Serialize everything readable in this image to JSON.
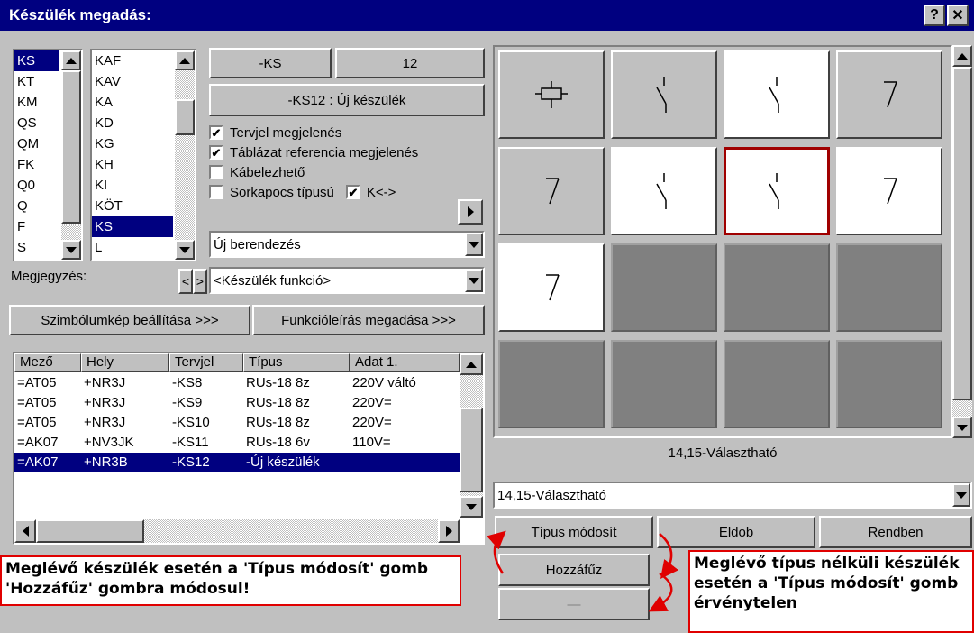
{
  "window": {
    "title": "Készülék megadás:",
    "help_label": "?",
    "close_label": "✕"
  },
  "prefix_list": {
    "items": [
      "KS",
      "KT",
      "KM",
      "QS",
      "QM",
      "FK",
      "Q0",
      "Q",
      "F",
      "S"
    ],
    "selected": 0
  },
  "type_list": {
    "items": [
      "KAF",
      "KAV",
      "KA",
      "KD",
      "KG",
      "KH",
      "KI",
      "KÖT",
      "KS",
      "L"
    ],
    "selected": 8
  },
  "designation": {
    "prefix": "-KS",
    "number": "12",
    "full": "-KS12  :  Új készülék"
  },
  "checkboxes": {
    "tervjel": {
      "label": "Tervjel megjelenés",
      "checked": true
    },
    "tablazat": {
      "label": "Táblázat referencia megjelenés",
      "checked": true
    },
    "kabelezheto": {
      "label": "Kábelezhető",
      "checked": false
    },
    "sorkapocs": {
      "label": "Sorkapocs típusú",
      "checked": false
    },
    "k": {
      "label": "K<->",
      "checked": true
    }
  },
  "berendezes_combo": {
    "value": "Új berendezés"
  },
  "megjegyzes": {
    "label": "Megjegyzés:",
    "nav_prev": "<",
    "nav_next": ">"
  },
  "funkcio_combo": {
    "value": "<Készülék funkció>"
  },
  "buttons": {
    "szimbolum": "Szimbólumkép beállítása >>>",
    "funkcio": "Funkcióleírás megadása >>>",
    "tipus_modosit": "Típus módosít",
    "eldob": "Eldob",
    "rendben": "Rendben",
    "hozzafuz": "Hozzáfűz",
    "disabled": "—"
  },
  "table": {
    "headers": [
      "Mező",
      "Hely",
      "Tervjel",
      "Típus",
      "Adat 1."
    ],
    "rows": [
      [
        "=AT05",
        "+NR3J",
        "-KS8",
        "RUs-18 8z",
        "220V váltó"
      ],
      [
        "=AT05",
        "+NR3J",
        "-KS9",
        "RUs-18 8z",
        "220V="
      ],
      [
        "=AT05",
        "+NR3J",
        "-KS10",
        "RUs-18 8z",
        "220V="
      ],
      [
        "=AK07",
        "+NV3JK",
        "-KS11",
        "RUs-18 6v",
        "110V="
      ],
      [
        "=AK07",
        "+NR3B",
        "-KS12",
        "-Új készülék",
        ""
      ]
    ],
    "selected_row": 4
  },
  "symbol_grid": {
    "caption": "14,15-Választható",
    "tiles": [
      {
        "style": "gray",
        "icon": "coil-icon"
      },
      {
        "style": "gray",
        "icon": "contact-no-icon"
      },
      {
        "style": "white",
        "icon": "contact-no-icon"
      },
      {
        "style": "gray",
        "icon": "contact-nc-icon"
      },
      {
        "style": "gray",
        "icon": "contact-nc-icon"
      },
      {
        "style": "white",
        "icon": "contact-no-icon"
      },
      {
        "style": "selected",
        "icon": "contact-no-icon"
      },
      {
        "style": "white",
        "icon": "contact-nc-icon"
      },
      {
        "style": "white",
        "icon": "contact-nc-icon"
      },
      {
        "style": "empty",
        "icon": ""
      },
      {
        "style": "empty",
        "icon": ""
      },
      {
        "style": "empty",
        "icon": ""
      },
      {
        "style": "empty",
        "icon": ""
      },
      {
        "style": "empty",
        "icon": ""
      },
      {
        "style": "empty",
        "icon": ""
      },
      {
        "style": "empty",
        "icon": ""
      }
    ]
  },
  "symbol_combo": {
    "value": "14,15-Választható"
  },
  "annotations": {
    "left": "Meglévő készülék esetén a 'Típus módosít' gomb 'Hozzáfűz' gombra módosul!",
    "right": "Meglévő típus nélküli készülék esetén a 'Típus módosít' gomb érvénytelen"
  },
  "colors": {
    "title_bg": "#000080",
    "selection": "#000080",
    "accent_red": "#e00000",
    "window_bg": "#c0c0c0"
  }
}
